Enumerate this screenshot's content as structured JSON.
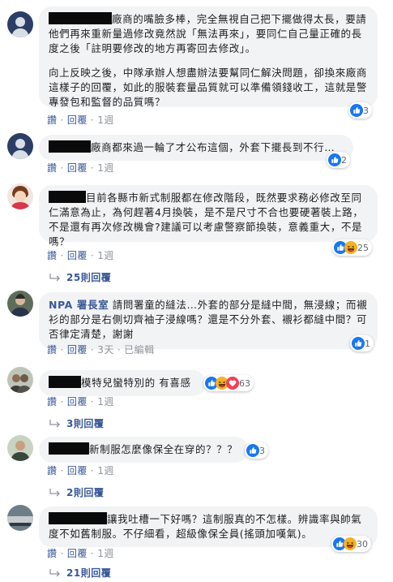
{
  "actions": {
    "like": "讚",
    "reply": "回覆",
    "sep": "·",
    "edited": "已編輯"
  },
  "comments": [
    {
      "p1": "廠商的嘴臉多棒，完全無視自己把下擺做得太長，要請他們再來重新量過修改竟然說「無法再來」，要同仁自己量正確的長度之後「註明要修改的地方再寄回去修改」。",
      "p2": "向上反映之後，中隊承辦人想盡辦法要幫同仁解決問題，卻換來廠商這樣子的回覆，如此的服裝套量品質就可以準備領錢收工，這就是警專發包和監督的品質嗎？",
      "time": "1週",
      "reactions": "3"
    },
    {
      "text": "廠商都來過一輪了才公布這個，外套下擺長到不行…",
      "time": "1週",
      "reactions": "2"
    },
    {
      "text": "目前各縣市新式制服都在修改階段，既然要求務必修改至同仁滿意為止，為何趕著4月換裝，是不是尺寸不合也要硬著裝上路，不是還有再次修改機會?建議可以考慮警察節換裝，意義重大，不是嗎？",
      "time": "1週",
      "reactions": "25",
      "replies": "25則回覆"
    },
    {
      "author": "NPA 署長室",
      "text": " 請問署童的縫法…外套的部分是縫中間，無浸線；而襯衫的部分是右側切齊袖子浸線嗎？還是不分外套、襯衫都縫中間？可否律定清楚，謝謝",
      "time": "3天",
      "reactions": "1"
    },
    {
      "text": "模特兒蠻特別的 有喜感",
      "time": "1週",
      "reactions": "63",
      "replies": "3則回覆"
    },
    {
      "text": "新制服怎麼像保全在穿的？？？",
      "time": "1週",
      "reactions": "3",
      "replies": "2則回覆"
    },
    {
      "text": "讓我吐槽一下好嗎？這制服真的不怎樣。辨識率與帥氣度不如舊制服。不仔細看，超級像保全員(搖頭加嘆氣)。",
      "time": "1週",
      "reactions": "30",
      "replies": "21則回覆"
    }
  ],
  "colors": {
    "link": "#385898",
    "bubble": "#f2f3f5",
    "meta": "#90949c",
    "like": "#1877f2",
    "haha": "#f7b125",
    "love": "#f33e58"
  }
}
